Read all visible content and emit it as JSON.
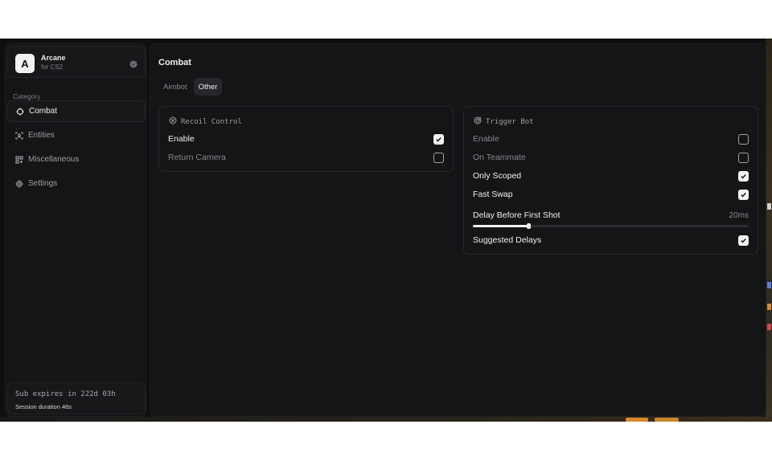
{
  "brand": {
    "name": "Arcane",
    "subtitle": "for CS2",
    "logo_letter": "A"
  },
  "sidebar": {
    "category_label": "Category",
    "items": [
      {
        "label": "Combat",
        "icon": "crosshair-icon",
        "active": true
      },
      {
        "label": "Entities",
        "icon": "entities-icon",
        "active": false
      },
      {
        "label": "Miscellaneous",
        "icon": "misc-icon",
        "active": false
      },
      {
        "label": "Settings",
        "icon": "gear-icon",
        "active": false
      }
    ],
    "sub_expires": "Sub expires in 222d 03h",
    "session": "Session duration 46s"
  },
  "main": {
    "title": "Combat",
    "tabs": [
      {
        "label": "Aimbot",
        "active": false
      },
      {
        "label": "Other",
        "active": true
      }
    ]
  },
  "recoil": {
    "title": "Recoil Control",
    "icon": "recoil-icon",
    "options": [
      {
        "label": "Enable",
        "checked": true
      },
      {
        "label": "Return Camera",
        "checked": false
      }
    ]
  },
  "trigger": {
    "title": "Trigger Bot",
    "icon": "target-icon",
    "options": [
      {
        "label": "Enable",
        "checked": false
      },
      {
        "label": "On Teammate",
        "checked": false
      },
      {
        "label": "Only Scoped",
        "checked": true
      },
      {
        "label": "Fast Swap",
        "checked": true
      }
    ],
    "delay": {
      "label": "Delay Before First Shot",
      "value_text": "20ms",
      "fraction": 0.2
    },
    "suggested": {
      "label": "Suggested Delays",
      "checked": true
    }
  },
  "colors": {
    "background": "#0e0f10",
    "panel": "#141516",
    "accent": "#f2f2f2",
    "muted": "#86888c"
  }
}
